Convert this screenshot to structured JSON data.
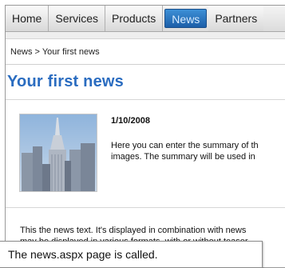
{
  "nav": {
    "tabs": [
      {
        "label": "Home"
      },
      {
        "label": "Services"
      },
      {
        "label": "Products"
      },
      {
        "label": "News",
        "active": true
      },
      {
        "label": "Partners"
      }
    ]
  },
  "breadcrumb": "News > Your first news",
  "page_title": "Your first news",
  "news_item": {
    "date": "1/10/2008",
    "summary_line1": "Here you can enter the summary of th",
    "summary_line2": "images. The summary will be used in"
  },
  "body": {
    "line1": "This the news text. It's displayed in combination with news",
    "line2": "may be displayed in various formats, with or without teaser"
  },
  "caption": "The news.aspx page is called.",
  "colors": {
    "title": "#2a6cc0",
    "active_tab": "#1c5fa8"
  }
}
